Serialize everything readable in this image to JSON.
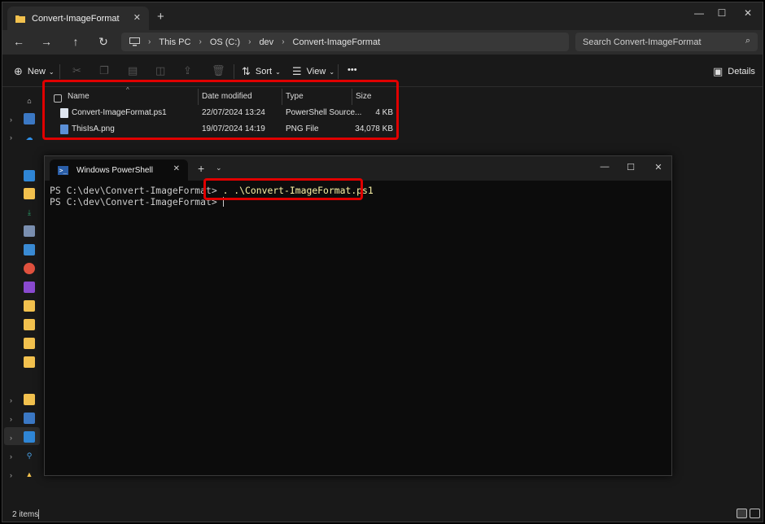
{
  "explorer": {
    "tab_title": "Convert-ImageFormat",
    "breadcrumb": [
      "This PC",
      "OS (C:)",
      "dev",
      "Convert-ImageFormat"
    ],
    "search_placeholder": "Search Convert-ImageFormat",
    "toolbar": {
      "new_label": "New",
      "sort_label": "Sort",
      "view_label": "View",
      "more_label": "•••",
      "details_label": "Details"
    },
    "columns": [
      "Name",
      "Date modified",
      "Type",
      "Size"
    ],
    "files": [
      {
        "name": "Convert-ImageFormat.ps1",
        "date": "22/07/2024 13:24",
        "type": "PowerShell Source...",
        "size": "4 KB"
      },
      {
        "name": "ThisIsA.png",
        "date": "19/07/2024 14:19",
        "type": "PNG File",
        "size": "34,078 KB"
      }
    ],
    "status": "2 items"
  },
  "powershell": {
    "tab_title": "Windows PowerShell",
    "lines": [
      {
        "prompt": "PS C:\\dev\\Convert-ImageFormat> ",
        "command": ". .\\Convert-ImageFormat.ps1"
      },
      {
        "prompt": "PS C:\\dev\\Convert-ImageFormat> ",
        "command": ""
      }
    ]
  },
  "colors": {
    "highlight": "#e00000",
    "command_text": "#f9f1a5",
    "folder": "#f2c14e"
  }
}
